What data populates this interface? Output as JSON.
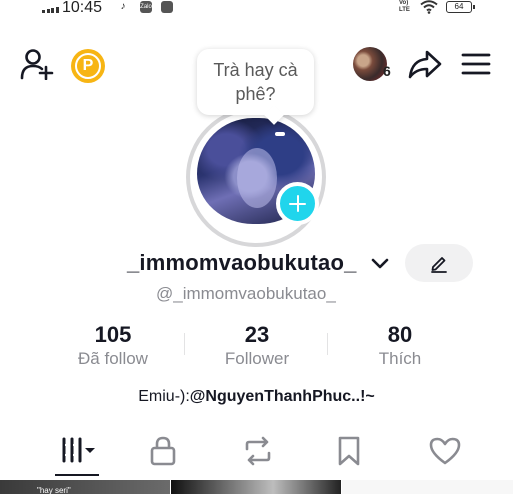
{
  "status_bar": {
    "time": "10:45",
    "apps": [
      "tiktok-icon",
      "zalo-icon",
      "app-icon"
    ],
    "zalo_label": "Zalo",
    "network": "Vo) LTE",
    "battery": "64"
  },
  "nav": {
    "add_friend_icon": "add-user-icon",
    "coin_letter": "P",
    "friends_badge_count": "6",
    "share_icon": "share-icon",
    "menu_icon": "menu-icon"
  },
  "note_bubble": {
    "text": "Trà hay cà phê?"
  },
  "profile": {
    "username": "_immomvaobukutao_",
    "handle": "@_immomvaobukutao_",
    "add_photo_icon": "plus-icon",
    "edit_icon": "pencil-icon"
  },
  "stats": [
    {
      "value": "105",
      "label": "Đã follow"
    },
    {
      "value": "23",
      "label": "Follower"
    },
    {
      "value": "80",
      "label": "Thích"
    }
  ],
  "bio": {
    "prefix": "Emiu-):",
    "mention": "@NguyenThanhPhuc..!~"
  },
  "tabs": [
    {
      "icon": "videos-grid-icon",
      "selected": true
    },
    {
      "icon": "lock-icon",
      "selected": false
    },
    {
      "icon": "repost-icon",
      "selected": false
    },
    {
      "icon": "bookmark-icon",
      "selected": false
    },
    {
      "icon": "heart-icon",
      "selected": false
    }
  ],
  "video_strip": {
    "first_caption": "\"hay seri\""
  },
  "colors": {
    "accent": "#20d5ec",
    "coin": "#f7b514",
    "text": "#161823",
    "muted": "#8a8b91"
  }
}
